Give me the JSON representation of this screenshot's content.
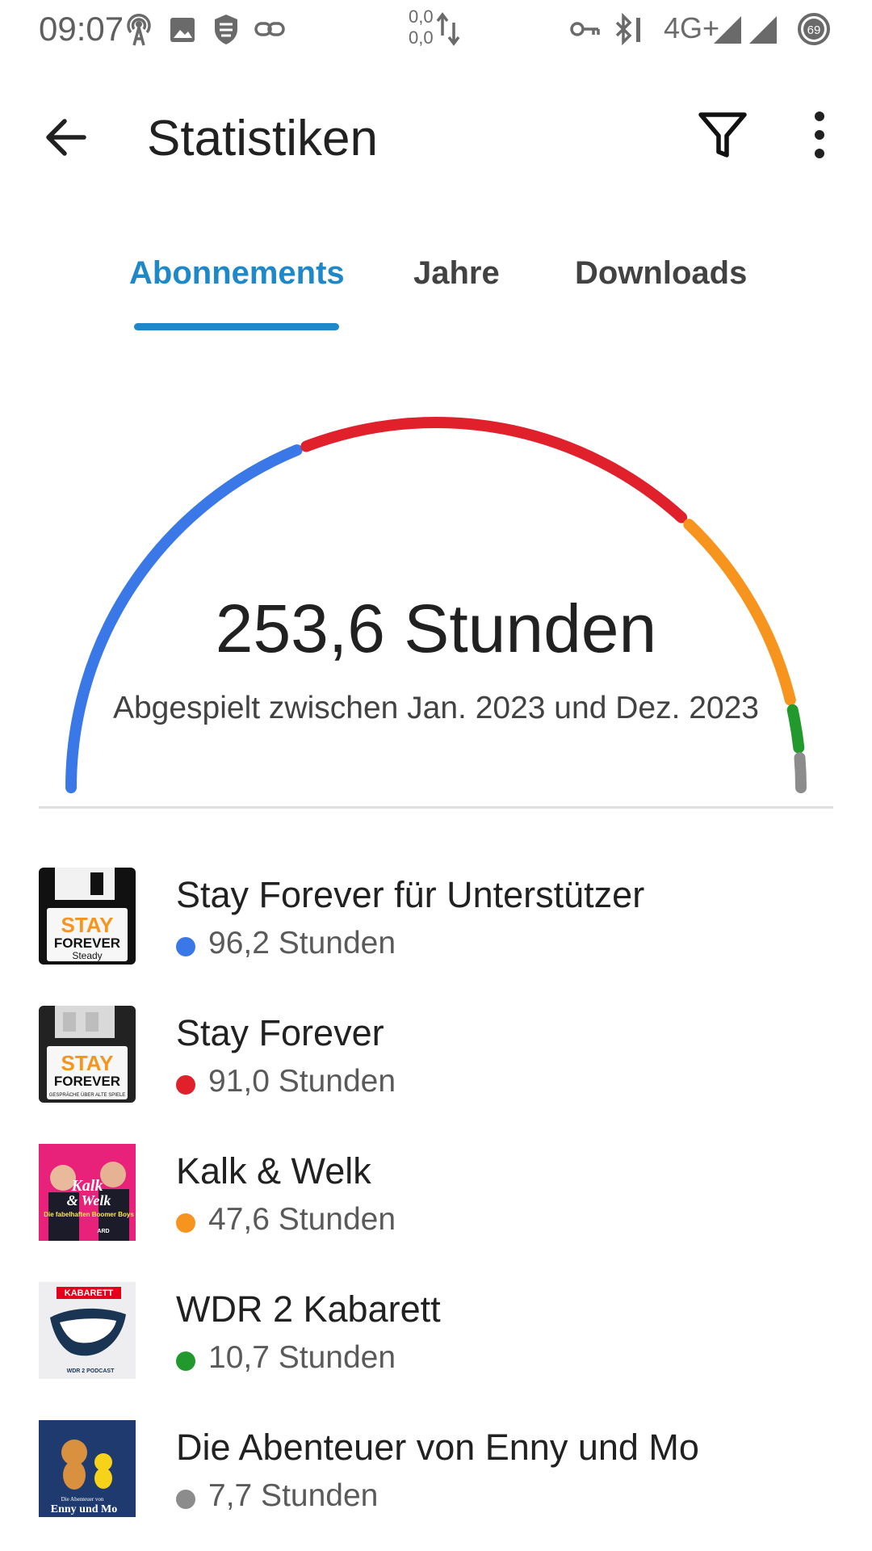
{
  "status_bar": {
    "time": "09:07",
    "data_up": "0,0",
    "data_down": "0,0",
    "network": "4G+",
    "battery": "69",
    "icons": [
      "hotspot-icon",
      "image-icon",
      "shield-icon",
      "link-icon",
      "data-arrows-icon",
      "vpn-key-icon",
      "bluetooth-icon",
      "signal-icon",
      "battery-icon"
    ]
  },
  "appbar": {
    "title": "Statistiken",
    "icons": [
      "back-arrow-icon",
      "filter-icon",
      "more-vert-icon"
    ]
  },
  "tabs": [
    {
      "label": "Abonnements",
      "active": true
    },
    {
      "label": "Jahre",
      "active": false
    },
    {
      "label": "Downloads",
      "active": false
    }
  ],
  "summary": {
    "total": "253,6 Stunden",
    "range": "Abgespielt zwischen Jan. 2023 und Dez. 2023"
  },
  "podcasts": [
    {
      "name": "Stay Forever für Unterstützer",
      "hours_label": "96,2 Stunden",
      "hours": 96.2,
      "color": "#3b78e7",
      "cover": "stay-forever-steady-cover",
      "cover_text": [
        "STAY",
        "FOREVER",
        "Steady"
      ]
    },
    {
      "name": "Stay Forever",
      "hours_label": "91,0 Stunden",
      "hours": 91.0,
      "color": "#e0202a",
      "cover": "stay-forever-cover",
      "cover_text": [
        "STAY",
        "FOREVER",
        "GESPRÄCHE ÜBER ALTE SPIELE"
      ]
    },
    {
      "name": "Kalk & Welk",
      "hours_label": "47,6 Stunden",
      "hours": 47.6,
      "color": "#f7941d",
      "cover": "kalk-welk-cover",
      "cover_text": [
        "Kalk",
        "& Welk",
        "Die fabelhaften Boomer Boys",
        "ARD"
      ]
    },
    {
      "name": "WDR 2 Kabarett",
      "hours_label": "10,7 Stunden",
      "hours": 10.7,
      "color": "#22992c",
      "cover": "wdr2-kabarett-cover",
      "cover_text": [
        "KABARETT",
        "WDR 2 PODCAST"
      ]
    },
    {
      "name": "Die Abenteuer von Enny und Mo",
      "hours_label": "7,7 Stunden",
      "hours": 7.7,
      "color": "#8c8c8c",
      "cover": "enny-mo-cover",
      "cover_text": [
        "Die Abenteuer von",
        "Enny und Mo"
      ]
    }
  ]
}
